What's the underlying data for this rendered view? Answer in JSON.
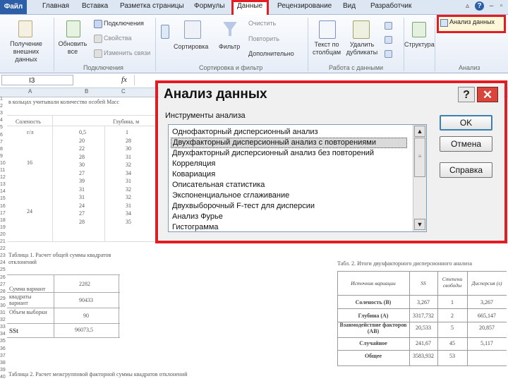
{
  "ribbon_tabs": {
    "file": "Файл",
    "items": [
      "Главная",
      "Вставка",
      "Разметка страницы",
      "Формулы",
      "Данные",
      "Рецензирование",
      "Вид",
      "Разработчик"
    ]
  },
  "ribbon": {
    "get_data": "Получение внешних данных",
    "refresh": "Обновить все",
    "connections": "Подключения",
    "properties": "Свойства",
    "edit_links": "Изменить связи",
    "group_connections": "Подключения",
    "sort": "Сортировка",
    "filter": "Фильтр",
    "clear": "Очистить",
    "reapply": "Повторить",
    "advanced": "Дополнительно",
    "group_sort_filter": "Сортировка и фильтр",
    "text_to_columns": "Текст по столбцам",
    "remove_duplicates": "Удалить дубликаты",
    "group_data_tools": "Работа с данными",
    "structure": "Структура",
    "data_analysis": "Анализ данных",
    "group_analysis": "Анализ"
  },
  "formula_bar": {
    "name_box": "I3",
    "fx": "fx"
  },
  "sheet": {
    "columns": [
      "A",
      "B",
      "C"
    ],
    "row1_text": "в кольцах учитывали количество особей Масс",
    "header_left": "Соленость",
    "header_right": "Глубина, м",
    "header_sub": "г/л",
    "col_b_values": [
      "0,5",
      "20",
      "22",
      "28",
      "30",
      "27",
      "39",
      "31",
      "31",
      "24",
      "27",
      "28"
    ],
    "col_c_values": [
      "1",
      "28",
      "30",
      "31",
      "32",
      "34",
      "31",
      "32",
      "32",
      "31",
      "34",
      "35"
    ],
    "salinity_values": [
      "16",
      "24"
    ],
    "table1_title": "Таблица 1. Расчет общей суммы квадратов отклонений",
    "table1_rows": [
      {
        "label": "Сумма вариант",
        "value": "2282"
      },
      {
        "label": "квадраты вариант",
        "value": "90433"
      },
      {
        "label": "Объем выборки",
        "value": "90"
      },
      {
        "label": "SSt",
        "value": "96073,5"
      }
    ],
    "table2_title": "Табл. 2. Итоги двухфакторного дисперсионного анализа",
    "table2_headers": [
      "Источник вариации",
      "SS",
      "Степени свободы",
      "Дисперсия (s)"
    ],
    "table2_rows": [
      {
        "source": "Соленость (B)",
        "ss": "3,267",
        "df": "1",
        "var": "3,267"
      },
      {
        "source": "Глубина (A)",
        "ss": "3317,732",
        "df": "2",
        "var": "665,147"
      },
      {
        "source": "Взаимодействие факторов (AB)",
        "ss": "20,533",
        "df": "5",
        "var": "20,857"
      },
      {
        "source": "Случайное",
        "ss": "241,67",
        "df": "45",
        "var": "5,117"
      },
      {
        "source": "Общее",
        "ss": "3583,932",
        "df": "53",
        "var": ""
      }
    ],
    "table3_title": "Таблица 2. Расчет межгрупповой факторной суммы квадратов отклонений",
    "row_numbers": [
      "1",
      "2",
      "3",
      "4",
      "5",
      "6",
      "7",
      "8",
      "9",
      "10",
      "11",
      "12",
      "13",
      "14",
      "15",
      "16",
      "17",
      "18",
      "19",
      "20",
      "21",
      "22",
      "23",
      "24",
      "25",
      "26",
      "27",
      "28",
      "29",
      "30",
      "31",
      "32",
      "33",
      "34",
      "35",
      "36",
      "37",
      "38",
      "39",
      "40"
    ]
  },
  "dialog": {
    "title": "Анализ данных",
    "help": "?",
    "close": "✕",
    "list_label": "Инструменты анализа",
    "items": [
      "Однофакторный дисперсионный анализ",
      "Двухфакторный дисперсионный анализ с повторениями",
      "Двухфакторный дисперсионный анализ без повторений",
      "Корреляция",
      "Ковариация",
      "Описательная статистика",
      "Экспоненциальное сглаживание",
      "Двухвыборочный F-тест для дисперсии",
      "Анализ Фурье",
      "Гистограмма"
    ],
    "selected_index": 1,
    "ok": "OK",
    "cancel": "Отмена",
    "help_button": "Справка"
  },
  "colors": {
    "highlight_red": "#e21c23",
    "file_tab": "#2c5fa8"
  }
}
